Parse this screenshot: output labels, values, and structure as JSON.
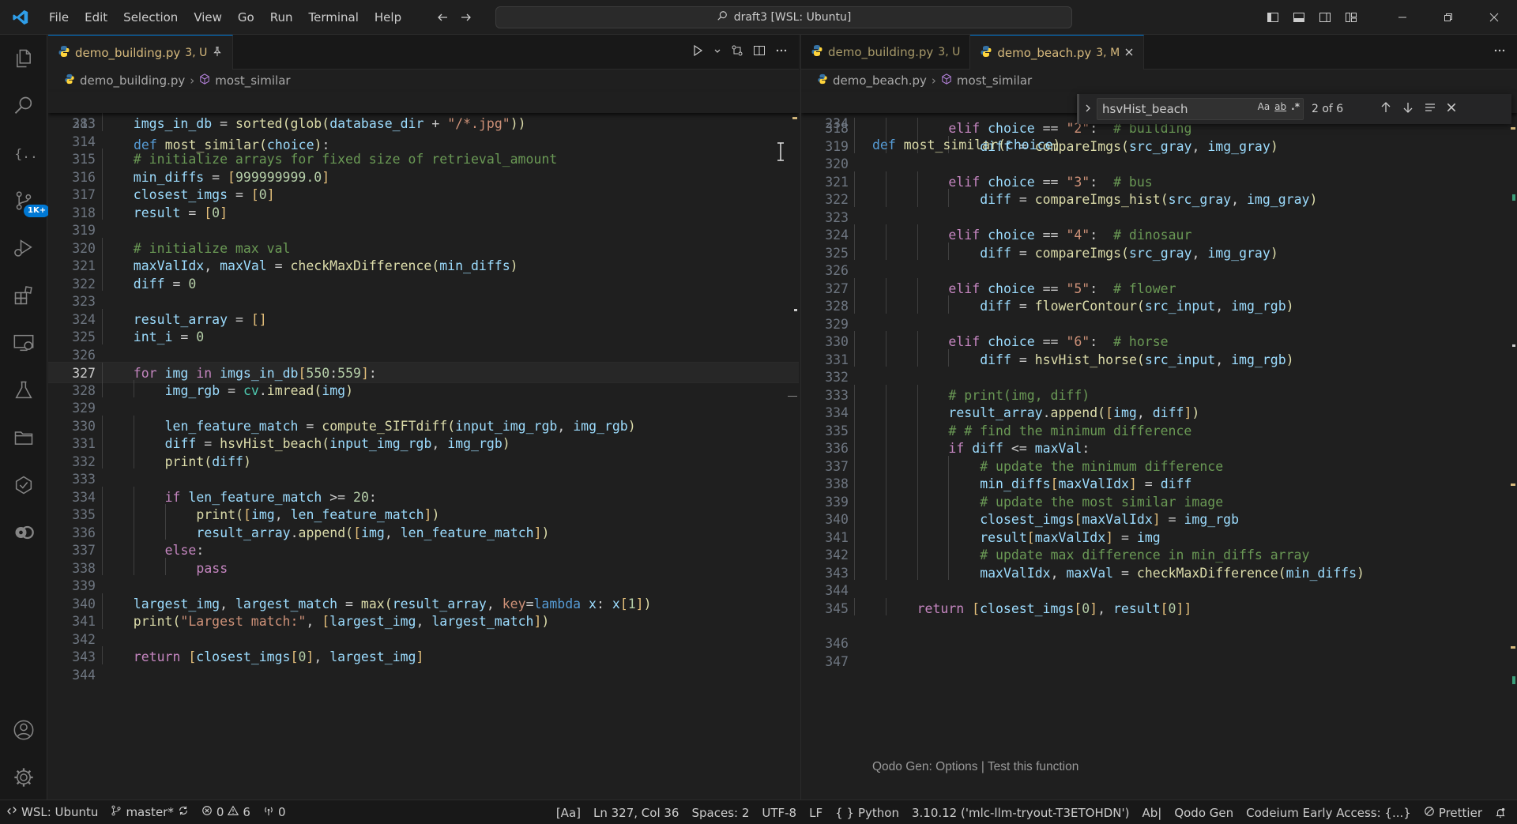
{
  "titlebar": {
    "menu": [
      "File",
      "Edit",
      "Selection",
      "View",
      "Go",
      "Run",
      "Terminal",
      "Help"
    ],
    "search": "draft3 [WSL: Ubuntu]"
  },
  "activity": {
    "badge": "1K+"
  },
  "left_editor": {
    "tab_file": "demo_building.py",
    "tab_status": "3, U",
    "breadcrumb_file": "demo_building.py",
    "breadcrumb_symbol": "most_similar",
    "sticky_ln": "283",
    "sticky_code": "def most_similar(choice):",
    "lines": [
      {
        "n": "313",
        "code": "imgs_in_db = sorted(glob(database_dir + \"/*.jpg\"))"
      },
      {
        "n": "314",
        "code": ""
      },
      {
        "n": "315",
        "code": "# initialize arrays for fixed size of retrieval_amount"
      },
      {
        "n": "316",
        "code": "min_diffs = [999999999.0]"
      },
      {
        "n": "317",
        "code": "closest_imgs = [0]"
      },
      {
        "n": "318",
        "code": "result = [0]"
      },
      {
        "n": "319",
        "code": ""
      },
      {
        "n": "320",
        "code": "# initialize max val"
      },
      {
        "n": "321",
        "code": "maxValIdx, maxVal = checkMaxDifference(min_diffs)"
      },
      {
        "n": "322",
        "code": "diff = 0"
      },
      {
        "n": "323",
        "code": ""
      },
      {
        "n": "324",
        "code": "result_array = []"
      },
      {
        "n": "325",
        "code": "int_i = 0"
      },
      {
        "n": "326",
        "code": ""
      },
      {
        "n": "327",
        "code": "for img in imgs_in_db[550:559]:"
      },
      {
        "n": "328",
        "code": "img_rgb = cv.imread(img)"
      },
      {
        "n": "329",
        "code": ""
      },
      {
        "n": "330",
        "code": "len_feature_match = compute_SIFTdiff(input_img_rgb, img_rgb)"
      },
      {
        "n": "331",
        "code": "diff = hsvHist_beach(input_img_rgb, img_rgb)"
      },
      {
        "n": "332",
        "code": "print(diff)"
      },
      {
        "n": "333",
        "code": ""
      },
      {
        "n": "334",
        "code": "if len_feature_match >= 20:"
      },
      {
        "n": "335",
        "code": "print([img, len_feature_match])"
      },
      {
        "n": "336",
        "code": "result_array.append([img, len_feature_match])"
      },
      {
        "n": "337",
        "code": "else:"
      },
      {
        "n": "338",
        "code": "pass"
      },
      {
        "n": "339",
        "code": ""
      },
      {
        "n": "340",
        "code": "largest_img, largest_match = max(result_array, key=lambda x: x[1])"
      },
      {
        "n": "341",
        "code": "print(\"Largest match:\", [largest_img, largest_match])"
      },
      {
        "n": "342",
        "code": ""
      },
      {
        "n": "343",
        "code": "return [closest_imgs[0], largest_img]"
      },
      {
        "n": "344",
        "code": ""
      }
    ]
  },
  "right_editor": {
    "tab1_file": "demo_building.py",
    "tab1_status": "3, U",
    "tab2_file": "demo_beach.py",
    "tab2_status": "3, M",
    "breadcrumb_file": "demo_beach.py",
    "breadcrumb_symbol": "most_similar",
    "sticky_ln": "234",
    "sticky_code": "def most_similar(choice)",
    "find": {
      "query": "hsvHist_beach",
      "count": "2 of 6",
      "opt_case": "Aa",
      "opt_word": "ab",
      "opt_regex": ".*"
    },
    "lines": [
      {
        "n": "318",
        "code": "elif choice == \"2\":  # building"
      },
      {
        "n": "319",
        "code": "diff = compareImgs(src_gray, img_gray)"
      },
      {
        "n": "320",
        "code": ""
      },
      {
        "n": "321",
        "code": "elif choice == \"3\":  # bus"
      },
      {
        "n": "322",
        "code": "diff = compareImgs_hist(src_gray, img_gray)"
      },
      {
        "n": "323",
        "code": ""
      },
      {
        "n": "324",
        "code": "elif choice == \"4\":  # dinosaur"
      },
      {
        "n": "325",
        "code": "diff = compareImgs(src_gray, img_gray)"
      },
      {
        "n": "326",
        "code": ""
      },
      {
        "n": "327",
        "code": "elif choice == \"5\":  # flower"
      },
      {
        "n": "328",
        "code": "diff = flowerContour(src_input, img_rgb)"
      },
      {
        "n": "329",
        "code": ""
      },
      {
        "n": "330",
        "code": "elif choice == \"6\":  # horse"
      },
      {
        "n": "331",
        "code": "diff = hsvHist_horse(src_input, img_rgb)"
      },
      {
        "n": "332",
        "code": ""
      },
      {
        "n": "333",
        "code": "# print(img, diff)"
      },
      {
        "n": "334",
        "code": "result_array.append([img, diff])"
      },
      {
        "n": "335",
        "code": "# # find the minimum difference"
      },
      {
        "n": "336",
        "code": "if diff <= maxVal:"
      },
      {
        "n": "337",
        "code": "# update the minimum difference"
      },
      {
        "n": "338",
        "code": "min_diffs[maxValIdx] = diff"
      },
      {
        "n": "339",
        "code": "# update the most similar image"
      },
      {
        "n": "340",
        "code": "closest_imgs[maxValIdx] = img_rgb"
      },
      {
        "n": "341",
        "code": "result[maxValIdx] = img"
      },
      {
        "n": "342",
        "code": "# update max difference in min_diffs array"
      },
      {
        "n": "343",
        "code": "maxValIdx, maxVal = checkMaxDifference(min_diffs)"
      },
      {
        "n": "344",
        "code": ""
      },
      {
        "n": "345",
        "code": "return [closest_imgs[0], result[0]]"
      },
      {
        "n": "346",
        "code": ""
      },
      {
        "n": "347",
        "code": ""
      }
    ],
    "codelens": "Qodo Gen: Options | Test this function"
  },
  "statusbar": {
    "remote": "WSL: Ubuntu",
    "branch": "master*",
    "errors": "0",
    "warnings": "6",
    "ports": "0",
    "aa": "[Aa]",
    "position": "Ln 327, Col 36",
    "spaces": "Spaces: 2",
    "encoding": "UTF-8",
    "eol": "LF",
    "language": "Python",
    "interpreter": "3.10.12 ('mlc-llm-tryout-T3ETOHDN')",
    "abl": "Ab|",
    "qodo": "Qodo Gen",
    "codeium": "Codeium Early Access: {...}",
    "prettier": "Prettier"
  },
  "colors": {
    "accent": "#0078d4",
    "tab_modified": "#d7ba7d"
  }
}
